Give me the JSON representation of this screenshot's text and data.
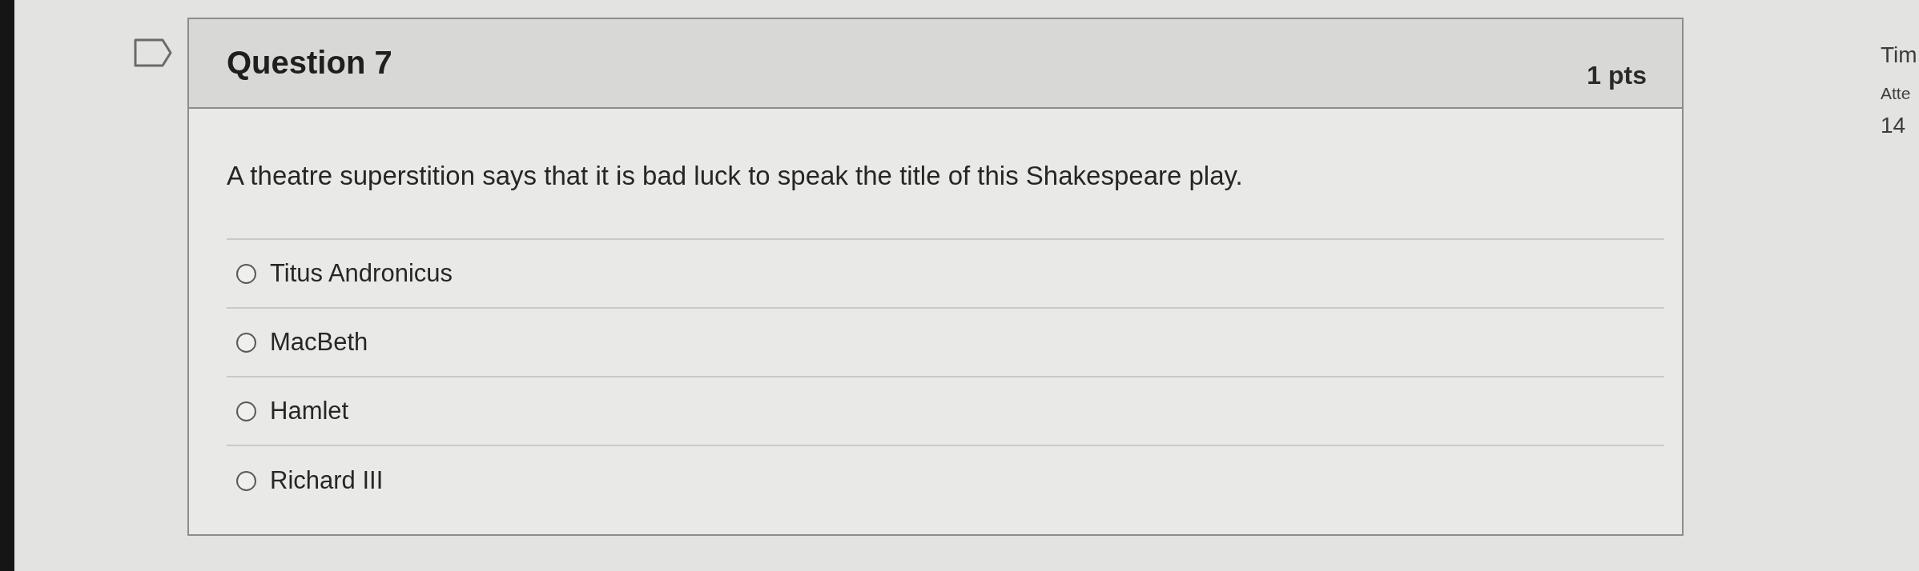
{
  "question": {
    "title": "Question 7",
    "points": "1 pts",
    "text": "A theatre superstition says that it is bad luck to speak the title of this Shakespeare play.",
    "answers": [
      {
        "label": "Titus Andronicus",
        "selected": false
      },
      {
        "label": "MacBeth",
        "selected": false
      },
      {
        "label": "Hamlet",
        "selected": false
      },
      {
        "label": "Richard III",
        "selected": false
      }
    ]
  },
  "sidebar": {
    "items": [
      {
        "text": "Tim",
        "kind": "heading"
      },
      {
        "text": "Atte",
        "kind": "label"
      },
      {
        "text": "14",
        "kind": "value"
      }
    ]
  }
}
